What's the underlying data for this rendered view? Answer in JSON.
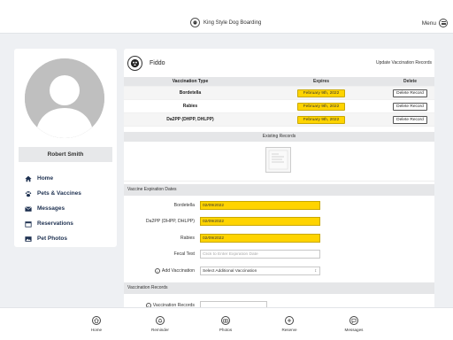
{
  "header": {
    "app_name": "King Style Dog Boarding",
    "menu_label": "Menu"
  },
  "profile": {
    "name": "Robert Smith"
  },
  "nav": {
    "items": [
      {
        "label": "Home",
        "icon": "home-icon"
      },
      {
        "label": "Pets & Vaccines",
        "icon": "paw-icon"
      },
      {
        "label": "Messages",
        "icon": "envelope-icon"
      },
      {
        "label": "Reservations",
        "icon": "calendar-icon"
      },
      {
        "label": "Pet Photos",
        "icon": "image-icon"
      }
    ]
  },
  "pet": {
    "name": "Fiddo",
    "update_link": "Update Vaccination Records"
  },
  "vaccines_table": {
    "headers": {
      "type": "Vaccination Type",
      "expires": "Expires",
      "delete": "Delete"
    },
    "rows": [
      {
        "type": "Bordetella",
        "expires": "February 9th, 2022",
        "action": "Delete Record"
      },
      {
        "type": "Rabies",
        "expires": "February 9th, 2022",
        "action": "Delete Record"
      },
      {
        "type": "Da2PP (DHPP, DHLPP)",
        "expires": "February 9th, 2022",
        "action": "Delete Record"
      }
    ]
  },
  "existing_records": {
    "title": "Existing Records"
  },
  "expiration_form": {
    "title": "Vaccine Expiration Dates",
    "bordetella": {
      "label": "Bordetella",
      "value": "02/09/2022"
    },
    "da2pp": {
      "label": "Da2PP (DHPP, DHLPP)",
      "value": "02/09/2022"
    },
    "rabies": {
      "label": "Rabies",
      "value": "02/09/2022"
    },
    "fecal": {
      "label": "Fecal Test",
      "placeholder": "Click to Enter Expiration Date"
    },
    "add_vaccination": {
      "label": "Add Vaccination",
      "selected": "Select Additional Vaccination"
    }
  },
  "records_section": {
    "title": "Vaccination Records",
    "field_label": "Vaccination Records"
  },
  "bottom_tabs": [
    {
      "label": "Home",
      "icon": "home-icon"
    },
    {
      "label": "Reminder",
      "icon": "bell-icon"
    },
    {
      "label": "Photos",
      "icon": "camera-icon"
    },
    {
      "label": "Reserve",
      "icon": "plus-icon"
    },
    {
      "label": "Messages",
      "icon": "chat-icon"
    }
  ],
  "colors": {
    "accent_yellow": "#ffd400",
    "nav_text": "#1d3050",
    "background": "#eef0f3"
  }
}
